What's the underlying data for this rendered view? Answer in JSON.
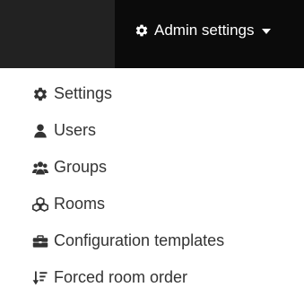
{
  "navbar": {
    "admin_label": "Admin settings",
    "admin_icon": "gear-icon",
    "colors": {
      "bar": "#222222",
      "active": "#0b0b0b",
      "text": "#ffffff"
    }
  },
  "menu": {
    "items": [
      {
        "label": "Settings",
        "icon": "gear-icon"
      },
      {
        "label": "Users",
        "icon": "user-icon"
      },
      {
        "label": "Groups",
        "icon": "users-group-icon"
      },
      {
        "label": "Rooms",
        "icon": "cubes-icon"
      },
      {
        "label": "Configuration templates",
        "icon": "briefcase-icon"
      },
      {
        "label": "Forced room order",
        "icon": "sort-amount-icon"
      }
    ],
    "text_color": "#333333"
  }
}
